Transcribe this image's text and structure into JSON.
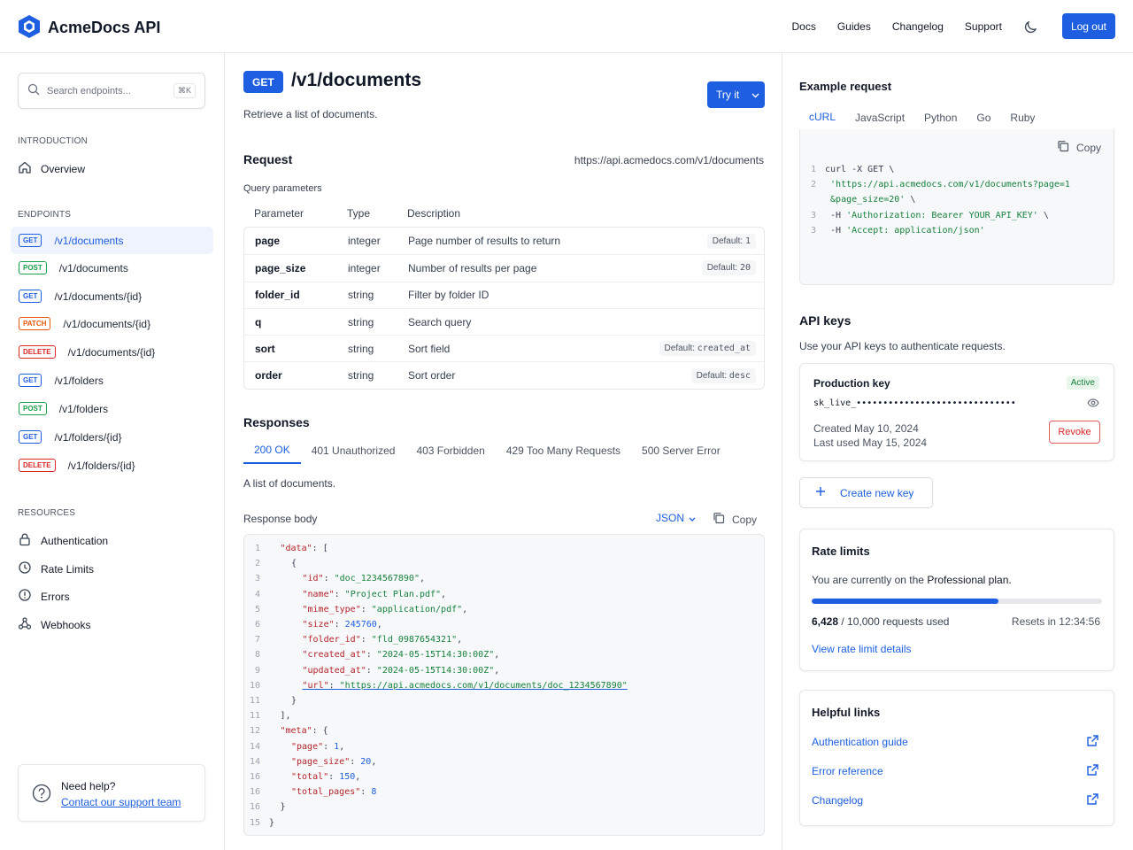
{
  "header": {
    "brand": "AcmeDocs API",
    "nav": [
      "Docs",
      "Guides",
      "Changelog",
      "Support"
    ],
    "logout_label": "Log out"
  },
  "sidebar": {
    "search_placeholder": "Search endpoints...",
    "search_shortcut": "⌘K",
    "intro_label": "INTRODUCTION",
    "overview_label": "Overview",
    "endpoints_label": "ENDPOINTS",
    "endpoints": [
      {
        "method": "GET",
        "path": "/v1/documents",
        "active": true
      },
      {
        "method": "POST",
        "path": "/v1/documents"
      },
      {
        "method": "GET",
        "path": "/v1/documents/{id}"
      },
      {
        "method": "PATCH",
        "path": "/v1/documents/{id}"
      },
      {
        "method": "DELETE",
        "path": "/v1/documents/{id}"
      },
      {
        "method": "GET",
        "path": "/v1/folders"
      },
      {
        "method": "POST",
        "path": "/v1/folders"
      },
      {
        "method": "GET",
        "path": "/v1/folders/{id}"
      },
      {
        "method": "DELETE",
        "path": "/v1/folders/{id}"
      }
    ],
    "resources_label": "RESOURCES",
    "resources": [
      "Authentication",
      "Rate Limits",
      "Errors",
      "Webhooks"
    ],
    "help_title": "Need help?",
    "help_link": "Contact our support team"
  },
  "main": {
    "method": "GET",
    "path": "/v1/documents",
    "try_label": "Try it",
    "description": "Retrieve a list of documents.",
    "request_title": "Request",
    "request_url": "https://api.acmedocs.com/v1/documents",
    "query_title": "Query parameters",
    "columns": [
      "Parameter",
      "Type",
      "Description"
    ],
    "params": [
      {
        "name": "page",
        "type": "integer",
        "desc": "Page number of results to return",
        "default_label": "Default:",
        "default_value": "1"
      },
      {
        "name": "page_size",
        "type": "integer",
        "desc": "Number of results per page",
        "default_label": "Default:",
        "default_value": "20"
      },
      {
        "name": "folder_id",
        "type": "string",
        "desc": "Filter by folder ID",
        "default_label": "",
        "default_value": ""
      },
      {
        "name": "q",
        "type": "string",
        "desc": "Search query",
        "default_label": "",
        "default_value": ""
      },
      {
        "name": "sort",
        "type": "string",
        "desc": "Sort field",
        "default_label": "Default:",
        "default_value": "created_at"
      },
      {
        "name": "order",
        "type": "string",
        "desc": "Sort order",
        "default_label": "Default:",
        "default_value": "desc"
      }
    ],
    "responses_title": "Responses",
    "response_tabs": [
      "200 OK",
      "401 Unauthorized",
      "403 Forbidden",
      "429 Too Many Requests",
      "500 Server Error"
    ],
    "response_desc": "A list of documents.",
    "body_title": "Response body",
    "format_label": "JSON",
    "copy_label": "Copy",
    "code_lines": [
      {
        "ln": "1",
        "indent": 1,
        "tokens": [
          [
            "k",
            "\"data\""
          ],
          [
            "p",
            ": ["
          ]
        ]
      },
      {
        "ln": "2",
        "indent": 2,
        "tokens": [
          [
            "p",
            "{"
          ]
        ]
      },
      {
        "ln": "3",
        "indent": 3,
        "tokens": [
          [
            "k",
            "\"id\""
          ],
          [
            "p",
            ": "
          ],
          [
            "s",
            "\"doc_1234567890\""
          ],
          [
            "p",
            ","
          ]
        ]
      },
      {
        "ln": "4",
        "indent": 3,
        "tokens": [
          [
            "k",
            "\"name\""
          ],
          [
            "p",
            ": "
          ],
          [
            "s",
            "\"Project Plan.pdf\""
          ],
          [
            "p",
            ","
          ]
        ]
      },
      {
        "ln": "5",
        "indent": 3,
        "tokens": [
          [
            "k",
            "\"mime_type\""
          ],
          [
            "p",
            ": "
          ],
          [
            "s",
            "\"application/pdf\""
          ],
          [
            "p",
            ","
          ]
        ]
      },
      {
        "ln": "6",
        "indent": 3,
        "tokens": [
          [
            "k",
            "\"size\""
          ],
          [
            "p",
            ": "
          ],
          [
            "n",
            "245760"
          ],
          [
            "p",
            ","
          ]
        ]
      },
      {
        "ln": "7",
        "indent": 3,
        "tokens": [
          [
            "k",
            "\"folder_id\""
          ],
          [
            "p",
            ": "
          ],
          [
            "s",
            "\"fld_0987654321\""
          ],
          [
            "p",
            ","
          ]
        ]
      },
      {
        "ln": "8",
        "indent": 3,
        "tokens": [
          [
            "k",
            "\"created_at\""
          ],
          [
            "p",
            ": "
          ],
          [
            "s",
            "\"2024-05-15T14:30:00Z\""
          ],
          [
            "p",
            ","
          ]
        ]
      },
      {
        "ln": "9",
        "indent": 3,
        "tokens": [
          [
            "k",
            "\"updated_at\""
          ],
          [
            "p",
            ": "
          ],
          [
            "s",
            "\"2024-05-15T14:30:00Z\""
          ],
          [
            "p",
            ","
          ]
        ]
      },
      {
        "ln": "10",
        "indent": 3,
        "url": true,
        "tokens": [
          [
            "k",
            "\"url\""
          ],
          [
            "p",
            ": "
          ],
          [
            "s",
            "\"https://api.acmedocs.com/v1/documents/doc_1234567890\""
          ]
        ]
      },
      {
        "ln": "11",
        "indent": 2,
        "tokens": [
          [
            "p",
            "}"
          ]
        ]
      },
      {
        "ln": "11",
        "indent": 1,
        "tokens": [
          [
            "p",
            "],"
          ]
        ]
      },
      {
        "ln": "12",
        "indent": 1,
        "tokens": [
          [
            "k",
            "\"meta\""
          ],
          [
            "p",
            ": {"
          ]
        ]
      },
      {
        "ln": "14",
        "indent": 2,
        "tokens": [
          [
            "k",
            "\"page\""
          ],
          [
            "p",
            ": "
          ],
          [
            "n",
            "1"
          ],
          [
            "p",
            ","
          ]
        ]
      },
      {
        "ln": "14",
        "indent": 2,
        "tokens": [
          [
            "k",
            "\"page_size\""
          ],
          [
            "p",
            ": "
          ],
          [
            "n",
            "20"
          ],
          [
            "p",
            ","
          ]
        ]
      },
      {
        "ln": "16",
        "indent": 2,
        "tokens": [
          [
            "k",
            "\"total\""
          ],
          [
            "p",
            ": "
          ],
          [
            "n",
            "150"
          ],
          [
            "p",
            ","
          ]
        ]
      },
      {
        "ln": "16",
        "indent": 2,
        "tokens": [
          [
            "k",
            "\"total_pages\""
          ],
          [
            "p",
            ": "
          ],
          [
            "n",
            "8"
          ]
        ]
      },
      {
        "ln": "16",
        "indent": 1,
        "tokens": [
          [
            "p",
            "}"
          ]
        ]
      },
      {
        "ln": "15",
        "indent": 0,
        "tokens": [
          [
            "p",
            "}"
          ]
        ]
      }
    ]
  },
  "right": {
    "example_title": "Example request",
    "lang_tabs": [
      "cURL",
      "JavaScript",
      "Python",
      "Go",
      "Ruby"
    ],
    "copy_label": "Copy",
    "curl_lines": [
      {
        "ln": "1",
        "tokens": [
          [
            "p",
            "curl -X GET \\"
          ]
        ]
      },
      {
        "ln": "2",
        "tokens": [
          [
            "p",
            " "
          ],
          [
            "s",
            "'https://api.acmedocs.com/v1/documents?page=1"
          ]
        ]
      },
      {
        "ln": "",
        "tokens": [
          [
            "p",
            " "
          ],
          [
            "s",
            "&page_size=20'"
          ],
          [
            "p",
            " \\"
          ]
        ]
      },
      {
        "ln": "3",
        "tokens": [
          [
            "p",
            " -H "
          ],
          [
            "s",
            "'Authorization: Bearer YOUR_API_KEY'"
          ],
          [
            "p",
            " \\"
          ]
        ]
      },
      {
        "ln": "3",
        "tokens": [
          [
            "p",
            " -H "
          ],
          [
            "s",
            "'Accept: application/json'"
          ]
        ]
      }
    ],
    "keys_title": "API keys",
    "keys_desc": "Use your API keys to authenticate requests.",
    "key_name": "Production key",
    "key_status": "Active",
    "key_value": "sk_live_••••••••••••••••••••••••••••••",
    "key_created": "Created May 10, 2024",
    "key_last_used": "Last used May 15, 2024",
    "revoke_label": "Revoke",
    "new_key_label": "Create new key",
    "rate_title": "Rate limits",
    "rate_desc_prefix": "You are currently on the ",
    "rate_plan": "Professional plan.",
    "rate_used": "6,428",
    "rate_total": "/ 10,000 requests used",
    "rate_fraction": 0.6428,
    "rate_reset": "Resets in 12:34:56",
    "rate_link": "View rate limit details",
    "links_title": "Helpful links",
    "links": [
      "Authentication guide",
      "Error reference",
      "Changelog"
    ]
  }
}
